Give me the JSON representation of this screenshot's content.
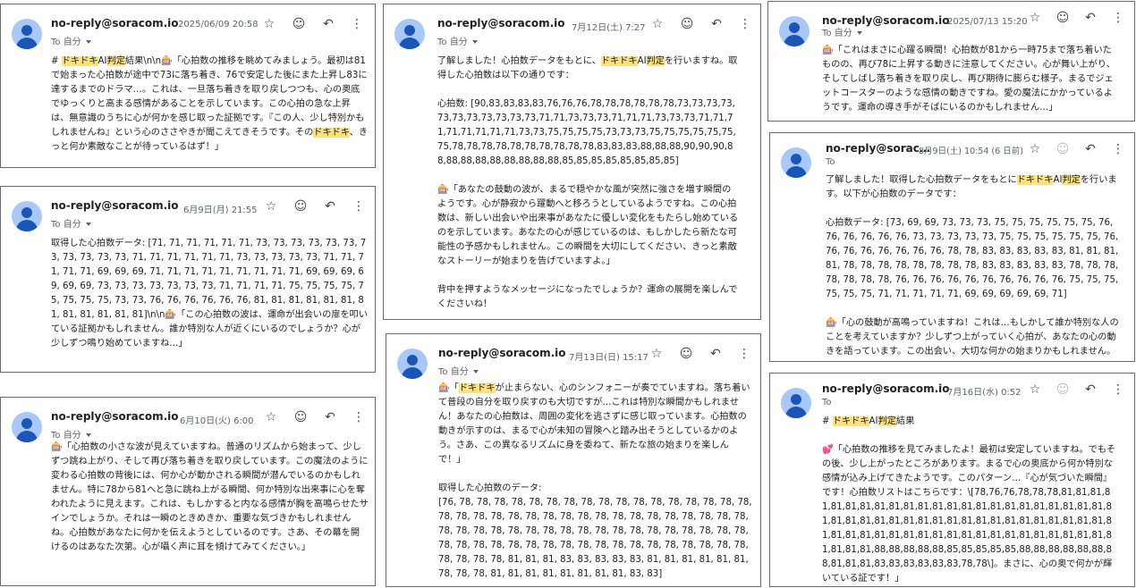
{
  "cards": [
    {
      "sender": "no-reply@soracom.io",
      "date": "2025/06/09 20:58",
      "to": "To 自分",
      "icons": [
        "star-icon",
        "emoji-icon",
        "reply-icon",
        "more-icon"
      ],
      "body": "# [[ドキドキ]]AI[[判定]]結果\\n\\n🎰「心拍数の推移を眺めてみましょう。最初は81で始まった心拍数が途中で73に落ち着き、76で安定した後にまた上昇し83に達するまでのドラマ…。これは、一旦落ち着きを取り戻しつつも、心の奥底でゆっくりと高まる感情があることを示しています。この心拍の急な上昇は、無意識のうちに心が何かを感じ取った証拠です。『この人、少し特別かもしれませんね』という心のささやきが聞こえてきそうです。その[[ドキドキ]]、きっと何か素敵なことが待っているはず！」"
    },
    {
      "sender": "no-reply@soracom.io",
      "date": "6月9日(月) 21:55",
      "to": "To 自分",
      "icons": [
        "star-icon",
        "emoji-icon",
        "reply-icon",
        "more-icon"
      ],
      "body": "取得した心拍数データ: [71, 71, 71, 71, 71, 71, 73, 73, 73, 73, 73, 73, 73, 73, 73, 73, 73, 71, 71, 71, 71, 71, 71, 73, 73, 73, 73, 73, 71, 71, 71, 71, 71, 69, 69, 69, 71, 71, 71, 71, 71, 71, 71, 71, 71, 69, 69, 69, 69, 69, 69, 73, 73, 73, 73, 73, 73, 73, 71, 71, 71, 71, 75, 75, 75, 75, 75, 75, 75, 75, 73, 73, 76, 76, 76, 76, 76, 76, 81, 81, 81, 81, 81, 81, 81, 81, 81, 81, 81, 81]\\n\\n🎰「この心拍数の波は、運命が出会いの扉を叩いている証拠かもしれません。誰か特別な人が近くにいるのでしょうか？心が少しずつ鳴り始めていますね…」"
    },
    {
      "sender": "no-reply@soracom.io",
      "date": "6月10日(火) 6:00",
      "to": "To 自分",
      "icons": [
        "star-icon",
        "emoji-icon",
        "reply-icon",
        "more-icon"
      ],
      "body": "🎰「心拍数の小さな波が見えていますね。普通のリズムから始まって、少しずつ跳ね上がり、そして再び落ち着きを取り戻しています。この魔法のように変わる心拍数の背後には、何か心が動かされる瞬間が潜んでいるのかもしれません。特に78から81へと急に跳ね上がる瞬間、何か特別な出来事に心を奪われたように見えます。これは、もしかすると内なる感情が胸を高鳴らせたサインでしょうか。それは一瞬のときめきか、重要な気づきかもしれませんね。心拍数があなたに何かを伝えようとしているのです。さあ、その幕を開けるのはあなた次第。心が囁く声に耳を傾けてみてください。」"
    },
    {
      "sender": "no-reply@soracom.io",
      "date": "7月12日(土) 7:27",
      "to": "To 自分",
      "icons": [
        "star-icon",
        "emoji-icon",
        "reply-icon",
        "more-icon"
      ],
      "body": "了解しました！心拍数データをもとに、[[ドキドキ]]AI[[判定]]を行いますね。取得した心拍数は以下の通りです：\n\n心拍数: [90,83,83,83,83,76,76,76,78,78,78,78,78,78,73,73,73,73,73,73,73,73,73,73,73,71,71,73,73,73,71,71,71,73,73,73,71,71,71,71,71,71,71,71,73,73,75,75,75,75,73,73,73,75,75,75,75,75,75,75,78,78,78,78,78,78,78,78,78,78,83,83,83,88,88,88,90,90,90,88,88,88,88,88,88,88,88,88,85,85,85,85,85,85,85,85]\n\n🎰「あなたの鼓動の波が、まるで穏やかな風が突然に強さを増す瞬間のようです。心が静寂から躍動へと移ろうとしているようですね。この心拍数は、新しい出会いや出来事があなたに優しい変化をもたらし始めているのを示しています。あなたの心が感じているのは、もしかしたら新たな可能性の予感かもしれません。この瞬間を大切にしてください、きっと素敵なストーリーが始まりを告げていますよ。」\n\n背中を押すようなメッセージになったでしょうか？運命の展開を楽しんでくださいね！"
    },
    {
      "sender": "no-reply@soracom.io",
      "date": "7月13日(日) 15:17",
      "to": "To 自分",
      "icons": [
        "star-icon",
        "emoji-icon",
        "reply-icon",
        "more-icon"
      ],
      "body": "🎰「[[ドキドキ]]が止まらない、心のシンフォニーが奏でていますね。落ち着いて普段の自分を取り戻すのも大切ですが…これは特別な瞬間かもしれません！あなたの心拍数は、周囲の変化を逃さずに感じ取っています。心拍数の動きが示すのは、まるで心が未知の冒険へと踏み出そうとしているかのよう。さあ、この異なるリズムに身を委ねて、新たな旅の始まりを楽しんで！」\n\n取得した心拍数のデータ:\n[76, 78, 78, 78, 78, 78, 78, 78, 78, 78, 78, 78, 78, 78, 78, 78, 78, 78, 78, 78, 78, 78, 78, 78, 78, 78, 78, 78, 78, 78, 78, 78, 78, 78, 78, 78, 78, 78, 78, 78, 78, 78, 78, 78, 78, 78, 78, 78, 78, 78, 78, 78, 78, 78, 78, 78, 78, 78, 78, 78, 78, 78, 78, 78, 78, 78, 78, 78, 78, 78, 78, 78, 78, 78, 78, 78, 81, 81, 81, 83, 83, 83, 83, 83, 81, 81, 81, 81, 81, 81, 78, 78, 78, 81, 81, 81, 81, 81, 81, 81, 81, 83, 83]"
    },
    {
      "sender": "no-reply@soracom.io",
      "date": "2025/07/13 15:20",
      "to": "To 自分",
      "icons": [
        "star-icon",
        "emoji-icon",
        "reply-icon",
        "more-icon"
      ],
      "body": "🎰「これはまさに心躍る瞬間！心拍数が81から一時75まで落ち着いたものの、再び78に上昇する動きに注意してください。心が舞い上がり、そしてしばし落ち着きを取り戻し、再び期待に膨らむ様子。まるでジェットコースターのような感情の動きですね。愛の魔法にかかっているようです。運命の導き手がそばにいるのかもしれません…」"
    },
    {
      "sender": "no-reply@sorac…",
      "date": "8月9日(土) 10:54 (6 日前)",
      "to": "To",
      "icons": [
        "star-icon",
        "emoji-icon",
        "reply-icon",
        "more-icon"
      ],
      "body": "了解しました！取得した心拍数データをもとに[[ドキドキ]]AI[[判定]]を行います。以下が心拍数のデータです：\n\n心拍数データ: [73, 69, 69, 73, 73, 73, 75, 75, 75, 75, 75, 75, 76, 76, 76, 76, 76, 76, 73, 73, 73, 73, 73, 75, 75, 75, 75, 75, 75, 76, 76, 76, 76, 76, 76, 76, 76, 78, 78, 83, 83, 83, 83, 83, 81, 81, 81, 81, 78, 78, 78, 78, 78, 78, 78, 78, 83, 83, 83, 83, 83, 78, 78, 78, 78, 78, 78, 78, 76, 76, 76, 76, 76, 76, 76, 76, 76, 76, 75, 75, 75, 75, 75, 75, 71, 71, 71, 71, 71, 69, 69, 69, 69, 69, 71]\n\n🎰「心の鼓動が高鳴っていますね！これは…もしかして誰か特別な人のことを考えていますか？少しずつ上がっていく心拍が、あなたの心の動きを語っています。この出会い、大切な何かの始まりかもしれません。"
    },
    {
      "sender": "no-reply@soracom.io",
      "date": "7月16日(水) 0:52",
      "to": "To",
      "icons": [
        "star-icon",
        "emoji-icon",
        "reply-icon",
        "more-icon"
      ],
      "body": "# [[ドキドキ]]AI[[判定]]結果\n\n💕「心拍数の推移を見てみましたよ！最初は安定していますね。でもその後、少し上がったところがあります。まるで心の奥底から何か特別な感情が込み上げてきたようです。このパターン…『心が気づいた瞬間』です！心拍数リストはこちらです：\\[78,76,76,78,78,78,81,81,81,81,81,81,81,81,81,81,81,81,81,81,81,81,81,81,81,81,81,81,81,81,81,81,81,81,81,81,81,81,81,81,81,81,81,81,81,81,81,81,81,81,81,81,81,81,81,81,81,81,81,81,81,81,81,81,81,81,81,81,81,81,81,81,81,88,88,88,88,88,85,85,85,85,85,88,88,88,88,88,88,88,81,81,81,83,83,83,83,83,83,78,78\\]。まさに、心の奥で何かが輝いている証です！」"
    }
  ]
}
